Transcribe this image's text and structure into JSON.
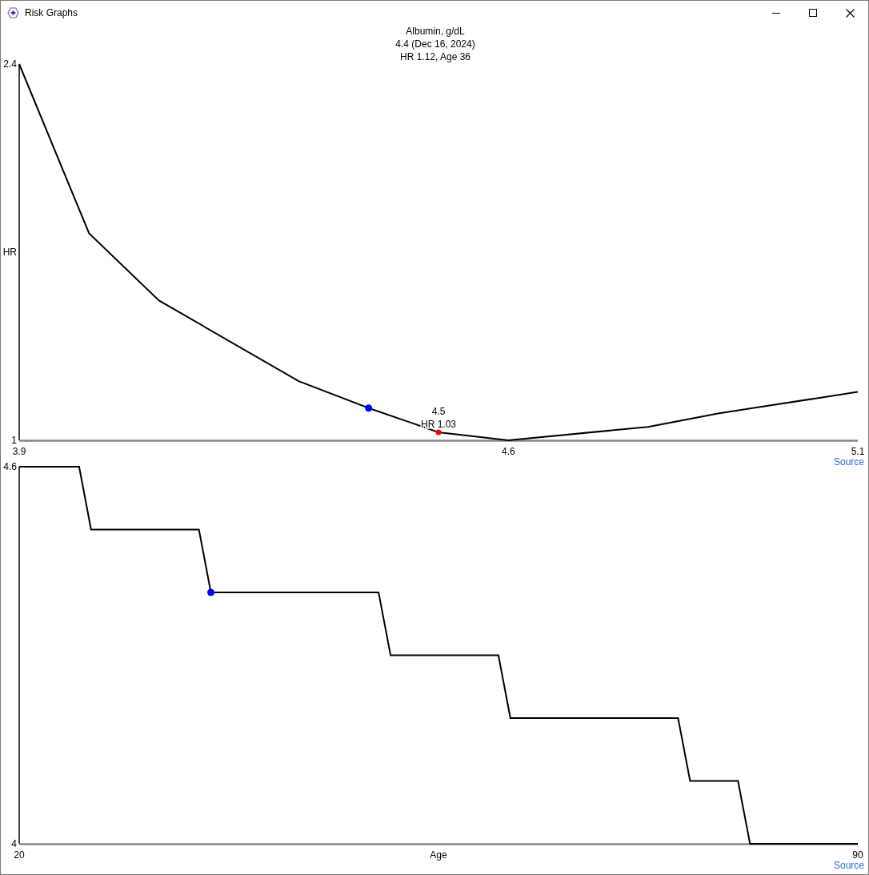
{
  "window": {
    "title": "Risk Graphs"
  },
  "header": {
    "lines": [
      "Albumin, g/dL",
      "4.4 (Dec 16, 2024)",
      "HR 1.12, Age 36"
    ]
  },
  "charts": [
    {
      "chart_data": {
        "type": "line",
        "ylabel": "HR",
        "x": [
          3.9,
          4.0,
          4.1,
          4.3,
          4.4,
          4.5,
          4.6,
          4.8,
          4.9,
          5.1
        ],
        "series": [
          {
            "color": "#000000",
            "values": [
              2.4,
              1.77,
              1.52,
              1.22,
              1.12,
              1.03,
              1.0,
              1.05,
              1.1,
              1.18
            ]
          },
          {
            "color": "#0000ff",
            "marker": "circle",
            "values": [
              null,
              null,
              null,
              null,
              1.12,
              null,
              null,
              null,
              null,
              null
            ]
          },
          {
            "color": "#ff0000",
            "marker": "circle",
            "values": [
              null,
              null,
              null,
              null,
              null,
              1.03,
              null,
              null,
              null,
              null
            ]
          }
        ],
        "xlim": [
          3.9,
          5.1
        ],
        "ylim": [
          1,
          2.4
        ],
        "xticks": [
          3.9,
          4.6,
          5.1
        ],
        "yticks": [
          2.4,
          1
        ],
        "annotations": [
          {
            "text": "4.5",
            "x": 4.5,
            "y": 1.03
          },
          {
            "text": "HR 1.03",
            "x": 4.5,
            "y": 1.03
          }
        ]
      },
      "source_link": "Source"
    },
    {
      "chart_data": {
        "type": "line",
        "xlabel": "Age",
        "x": [
          20,
          25,
          26,
          35,
          36,
          50,
          51,
          60,
          61,
          75,
          76,
          80,
          81,
          90
        ],
        "series": [
          {
            "color": "#000000",
            "values": [
              4.6,
              4.6,
              4.5,
              4.5,
              4.4,
              4.4,
              4.3,
              4.3,
              4.2,
              4.2,
              4.1,
              4.1,
              4.0,
              4.0
            ]
          },
          {
            "color": "#0000ff",
            "marker": "circle",
            "values": [
              null,
              null,
              null,
              null,
              4.4,
              null,
              null,
              null,
              null,
              null,
              null,
              null,
              null,
              null
            ]
          }
        ],
        "xlim": [
          20,
          90
        ],
        "ylim": [
          4,
          4.6
        ],
        "xticks": [
          20,
          90
        ],
        "yticks": [
          4.6,
          4
        ]
      },
      "source_link": "Source"
    }
  ]
}
